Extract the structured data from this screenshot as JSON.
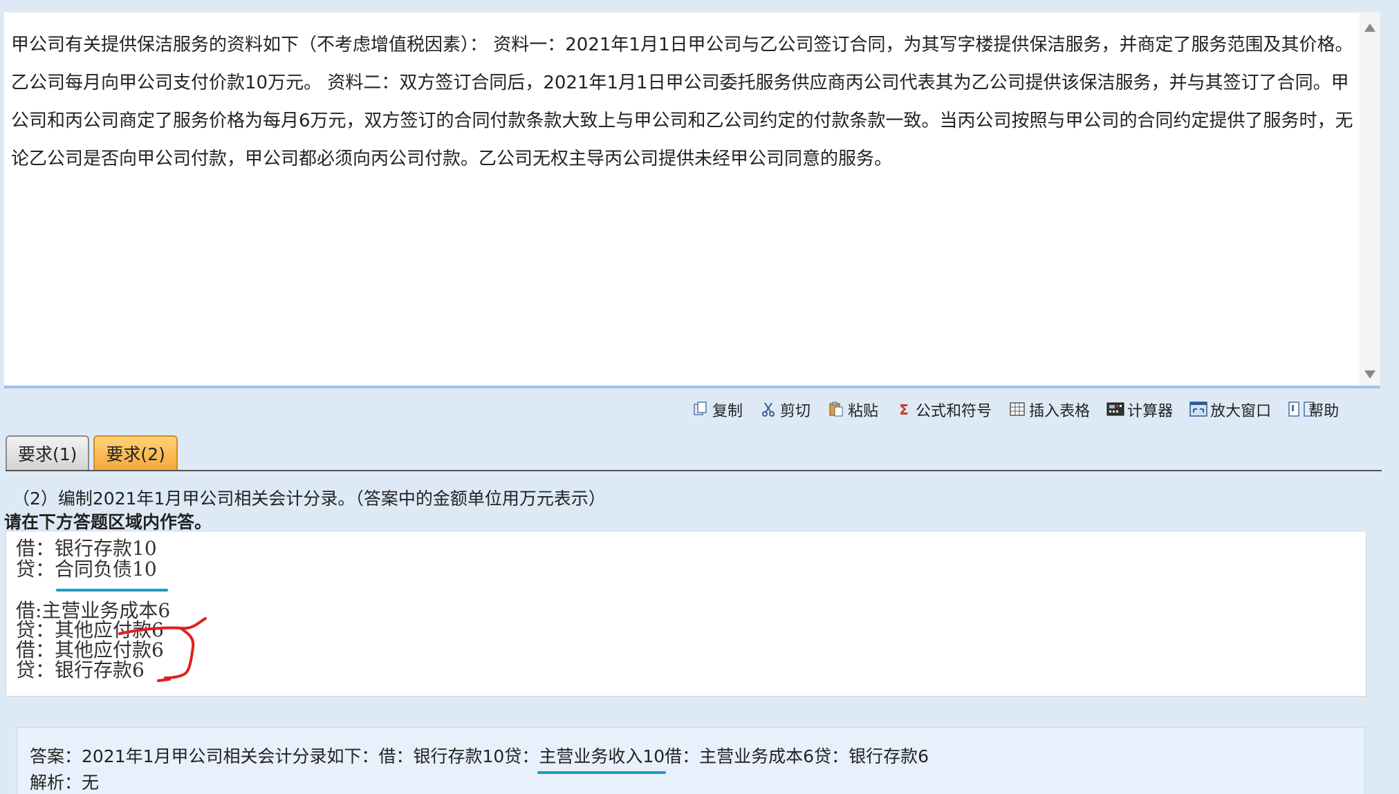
{
  "question": {
    "text": "甲公司有关提供保洁服务的资料如下（不考虑增值税因素）： 资料一：2021年1月1日甲公司与乙公司签订合同，为其写字楼提供保洁服务，并商定了服务范围及其价格。乙公司每月向甲公司支付价款10万元。 资料二：双方签订合同后，2021年1月1日甲公司委托服务供应商丙公司代表其为乙公司提供该保洁服务，并与其签订了合同。甲公司和丙公司商定了服务价格为每月6万元，双方签订的合同付款条款大致上与甲公司和乙公司约定的付款条款一致。当丙公司按照与甲公司的合同约定提供了服务时，无论乙公司是否向甲公司付款，甲公司都必须向丙公司付款。乙公司无权主导丙公司提供未经甲公司同意的服务。"
  },
  "toolbar": [
    {
      "label": "复制",
      "icon": "copy-icon"
    },
    {
      "label": "剪切",
      "icon": "scissors-icon"
    },
    {
      "label": "粘贴",
      "icon": "paste-icon"
    },
    {
      "label": "公式和符号",
      "icon": "sigma-icon"
    },
    {
      "label": "插入表格",
      "icon": "table-icon"
    },
    {
      "label": "计算器",
      "icon": "calculator-icon"
    },
    {
      "label": "放大窗口",
      "icon": "enlarge-window-icon"
    },
    {
      "label": "帮助",
      "icon": "help-book-icon"
    }
  ],
  "tabs": [
    {
      "label": "要求(1)",
      "active": false
    },
    {
      "label": "要求(2)",
      "active": true
    }
  ],
  "requirement": "（2）编制2021年1月甲公司相关会计分录。（答案中的金额单位用万元表示）",
  "instruction": "请在下方答题区域内作答。",
  "answer_lines": [
    "借：银行存款10",
    "贷：合同负债10",
    "借:主营业务成本6",
    "贷：其他应付款6",
    "借：其他应付款6",
    "贷：银行存款6"
  ],
  "solution": {
    "answer_prefix": "答案：2021年1月甲公司相关会计分录如下：借：银行存款10贷：",
    "answer_highlight": "主营业务收入10",
    "answer_suffix": "借：主营业务成本6贷：银行存款6",
    "analysis": "解析：无"
  },
  "colors": {
    "annotation_blue": "#1a9cc4",
    "annotation_red": "#e0201c",
    "active_tab": "#f4a93c"
  }
}
